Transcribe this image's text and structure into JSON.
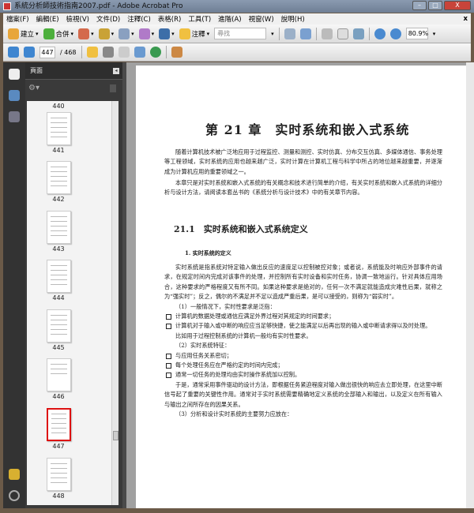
{
  "window": {
    "title": "系統分析師技術指南2007.pdf - Adobe Acrobat Pro",
    "min": "–",
    "max": "□",
    "close": "X"
  },
  "menu": [
    "檔案(F)",
    "編輯(E)",
    "檢視(V)",
    "文件(D)",
    "注釋(C)",
    "表格(R)",
    "工具(T)",
    "進階(A)",
    "視窗(W)",
    "說明(H)"
  ],
  "menu_close": "x",
  "toolbar": {
    "create": "建立",
    "combine": "合併",
    "comment": "注釋",
    "search_placeholder": "尋找",
    "zoom": "80.9%",
    "page_current": "447",
    "page_total": "/ 468"
  },
  "panel": {
    "title": "頁面",
    "thumbnails": [
      "440",
      "441",
      "442",
      "443",
      "444",
      "445",
      "446",
      "447",
      "448"
    ],
    "selected": "447"
  },
  "doc": {
    "chapter_title": "第 21 章　实时系统和嵌入式系统",
    "intro1": "随着计算机技术被广泛地应用于过程监控、测量和测控、实时仿真、分布交互仿真、多媒体通信、事务处理等工程领域，实时系统的应用也越来越广泛，实时计算在计算机工程与科学中所占的地位越来越重要，并逐渐成为计算机应用的重要领域之一。",
    "intro2": "本章只是对实时系统和嵌入式系统的有关概念和技术进行简单的介绍，有关实时系统和嵌入式系统的详细分析与设计方法，请阅读本套丛书的《系统分析与设计技术》中的有关章节内容。",
    "section": "21.1　实时系统和嵌入式系统定义",
    "subsection": "1. 实时系统的定义",
    "def": "实时系统是指系统对特定输入做出反应的速度足以控制被控对象；或者说，系统能及时响应外部事件的请求，在规定时间内完成对该事件的处理，并控制所有实时设备和实时任务，协调一致地运行。针对具体应用场合，这种要求的严格程度又有所不同。如果这种要求是绝对的，任何一次不满足就能造成灾难性后果，就称之为“强实时”；反之，偶尔的不满足并不足以造成严重后果，是可以接受的，则称为“弱实时”。",
    "p1": "（1）一般情况下，实时性要求是泛指：",
    "b1": "计算机的数据处理或通信应满足外界过程对其规定的时间要求；",
    "b2": "计算机对于输入或中断的响应应当足够快捷，使之能满足以后再出现的输入或中断请求得以及时处理。",
    "p1b": "比如用于过程控制系统的计算机一般均有实时性要求。",
    "p2": "（2）实时系统特征：",
    "b3": "与应用任务关系密切；",
    "b4": "每个处理任务应在严格约定的时间内完成；",
    "b5": "通常一切任务的处理均由实时操作系统加以控制。",
    "p3": "于是，通常采用事件驱动的设计方法，即根据任务紧迫程度对输入做出很快的响应去立即处理，在这里中断信号起了重要的关键性作用。通常对于实时系统需要精确地定义系统的全部输入和输出，以及定义在所有输入与输出之间所存在的因果关系。",
    "p4": "（3）分析和设计实时系统的主要努力应放在："
  }
}
